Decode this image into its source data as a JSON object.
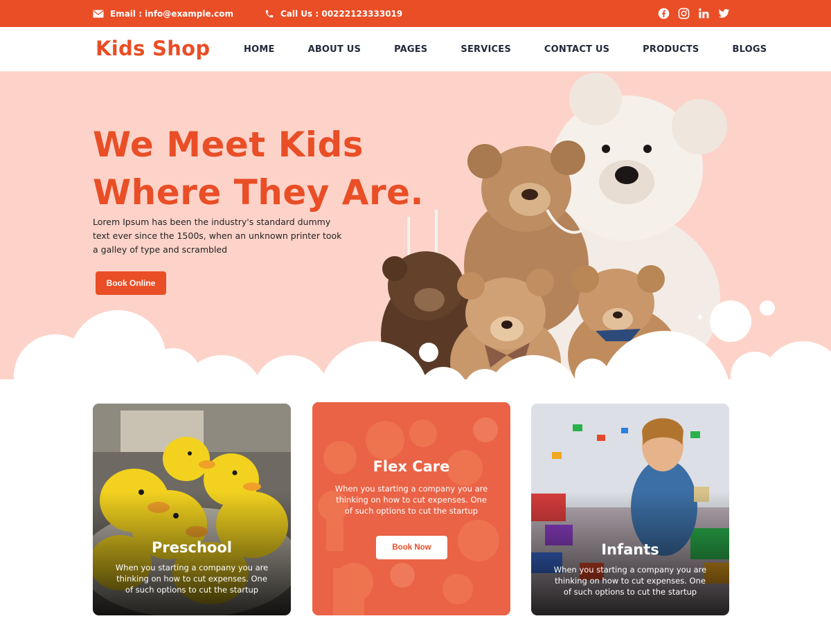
{
  "topbar": {
    "email_text": "Email : info@example.com",
    "phone_text": "Call Us : 00222123333019",
    "social": [
      "facebook-icon",
      "instagram-icon",
      "linkedin-icon",
      "twitter-icon"
    ]
  },
  "nav": {
    "logo": "Kids Shop",
    "items": [
      "HOME",
      "ABOUT US",
      "PAGES",
      "SERVICES",
      "CONTACT US",
      "PRODUCTS",
      "BLOGS"
    ]
  },
  "hero": {
    "title_line1": "We Meet Kids",
    "title_line2": "Where They Are.",
    "description": "Lorem Ipsum has been the industry's standard dummy text ever since the 1500s, when an unknown printer took a galley of type and scrambled",
    "button": "Book Online"
  },
  "cards": [
    {
      "title": "Preschool",
      "description": "When you starting a company you are thinking on how to cut expenses. One of such options to cut the startup"
    },
    {
      "title": "Flex Care",
      "description": "When you starting a company you are thinking on how to cut expenses. One of such options to cut the startup",
      "button": "Book Now"
    },
    {
      "title": "Infants",
      "description": "When you starting a company you are thinking on how to cut expenses. One of such options to cut the startup"
    }
  ],
  "colors": {
    "accent": "#e94e26",
    "hero_bg": "#fdd3c9",
    "nav_text": "#23283a"
  }
}
